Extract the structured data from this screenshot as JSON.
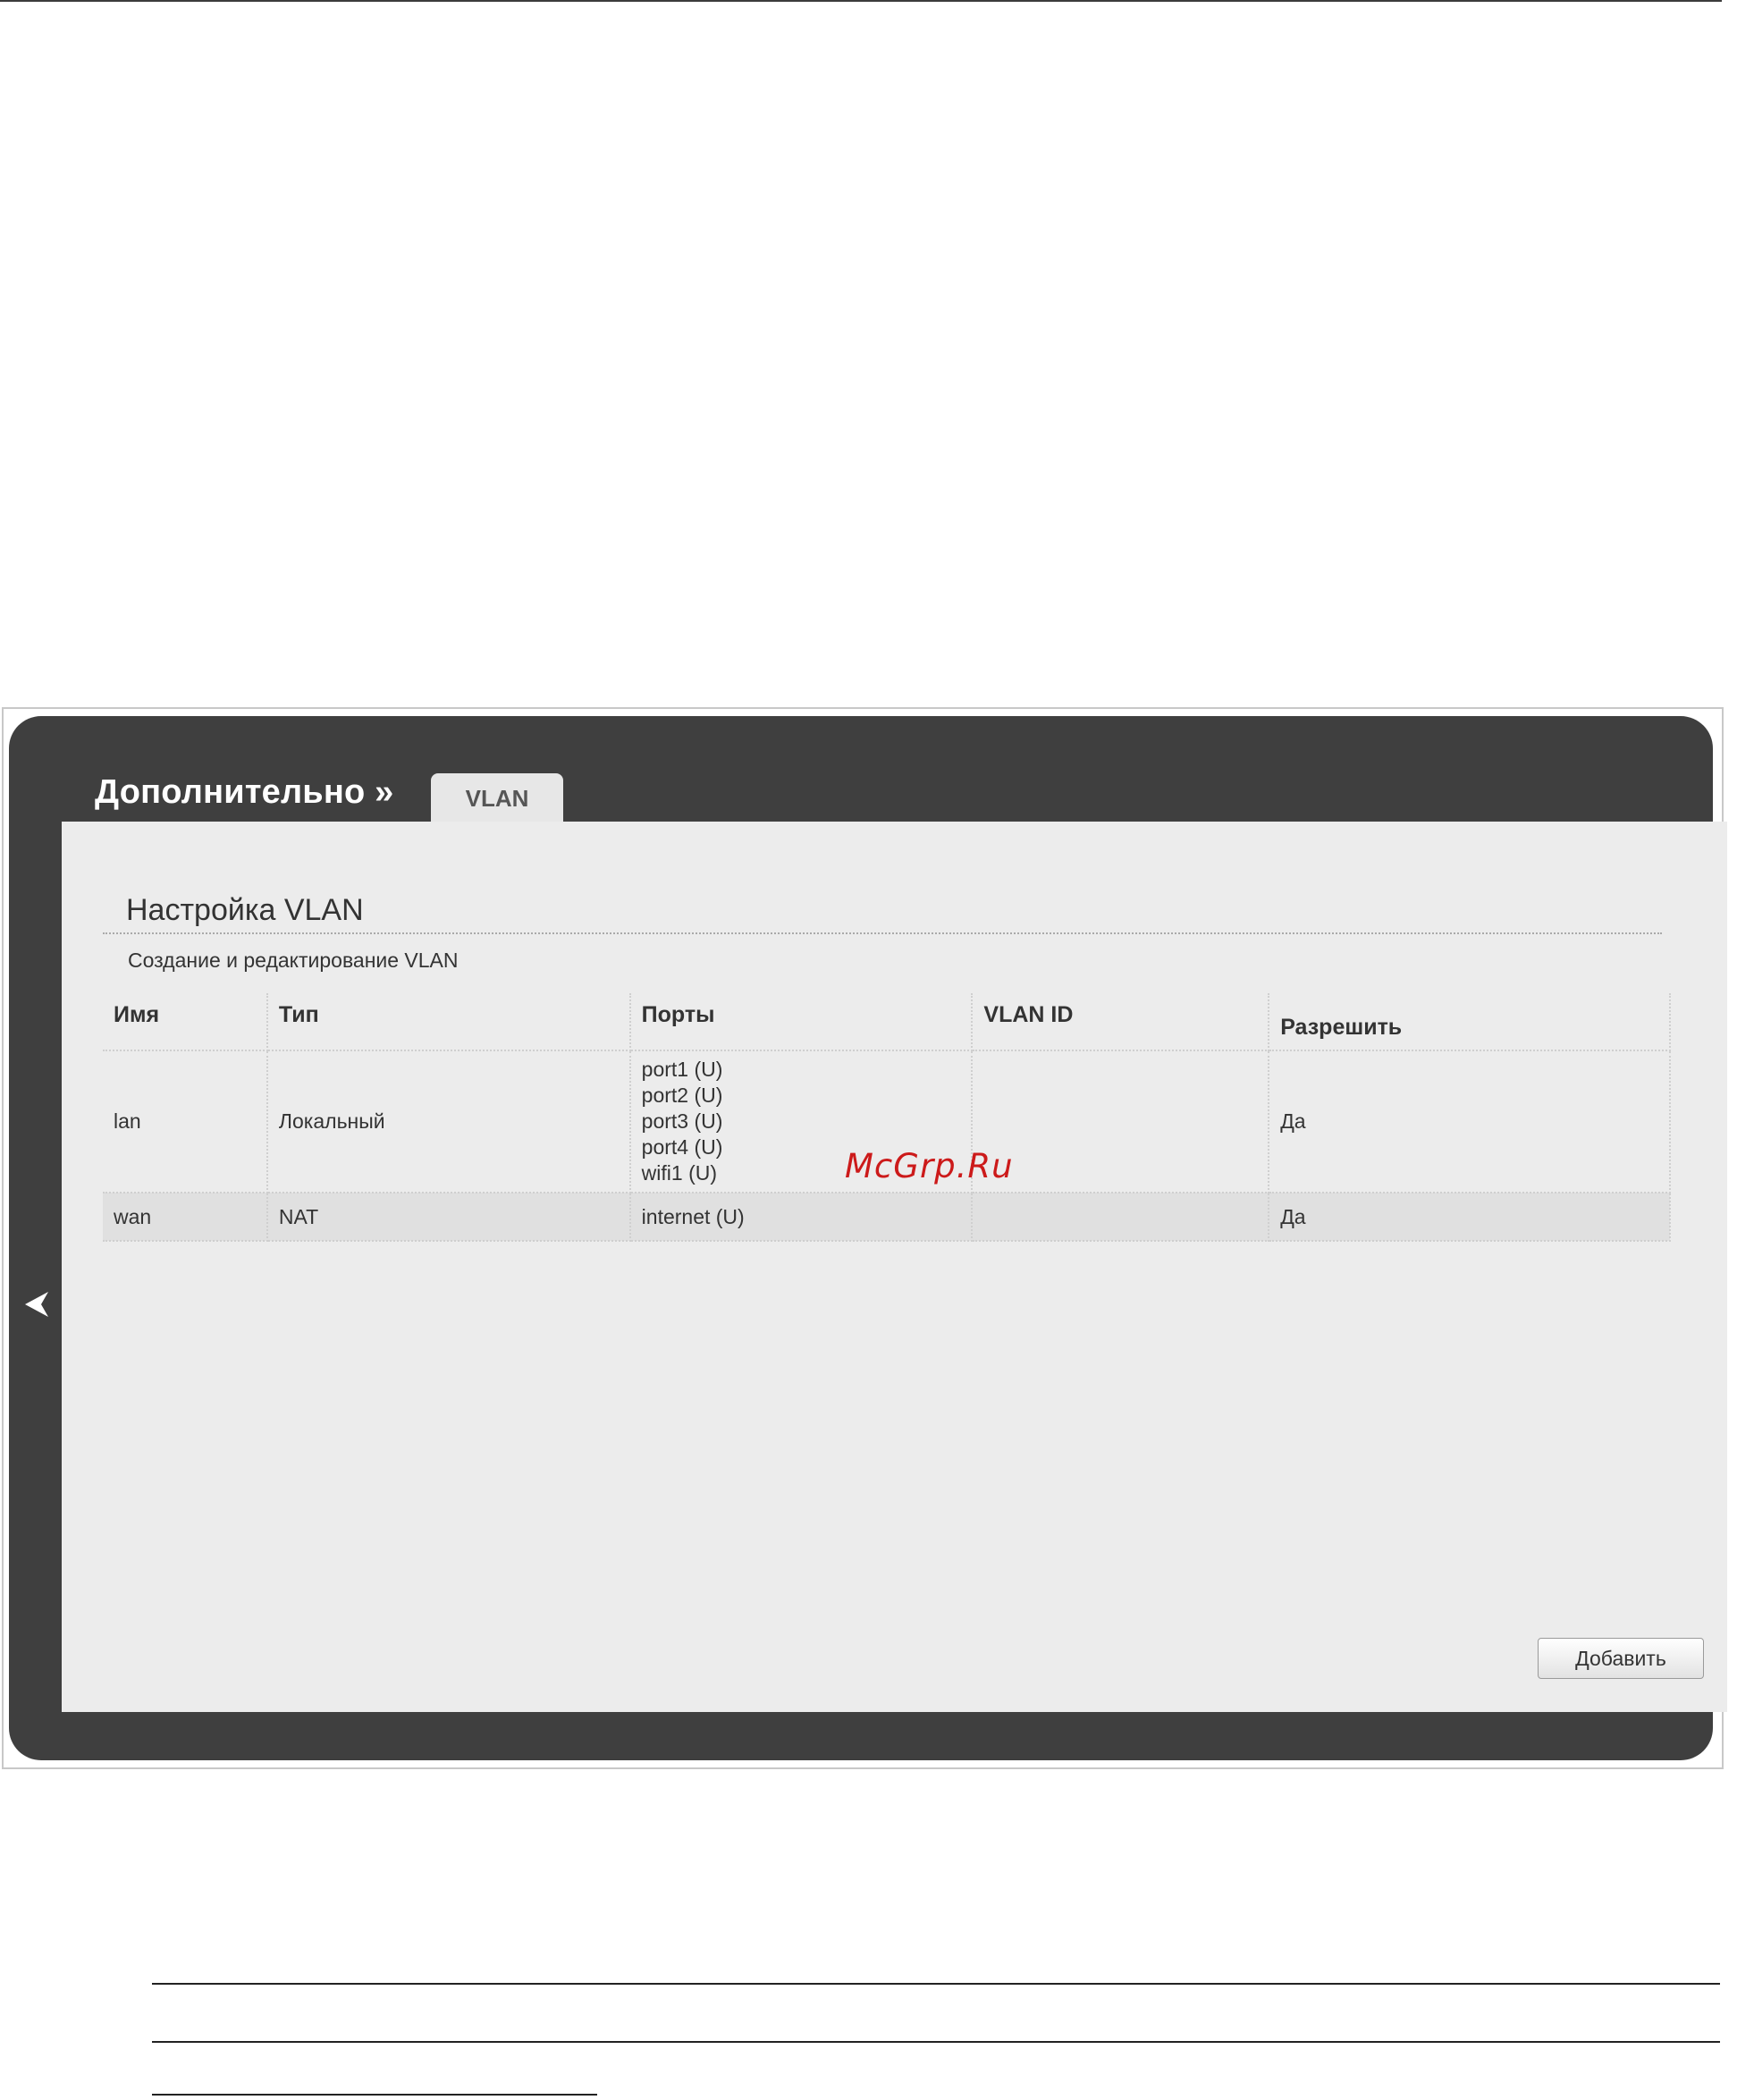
{
  "header": {
    "section": "Дополнительно »",
    "tab": "VLAN"
  },
  "content": {
    "title": "Настройка VLAN",
    "subtitle": "Создание и редактирование VLAN"
  },
  "table": {
    "columns": [
      "Имя",
      "Тип",
      "Порты",
      "VLAN ID",
      "Разрешить"
    ],
    "rows": [
      {
        "name": "lan",
        "type": "Локальный",
        "ports": [
          "port1 (U)",
          "port2 (U)",
          "port3 (U)",
          "port4 (U)",
          "wifi1 (U)"
        ],
        "vlan_id": "",
        "enabled": "Да"
      },
      {
        "name": "wan",
        "type": "NAT",
        "ports": [
          "internet (U)"
        ],
        "vlan_id": "",
        "enabled": "Да"
      }
    ]
  },
  "actions": {
    "add_label": "Добавить"
  },
  "watermark": "McGrp.Ru",
  "icons": {
    "back": "chevron-left-icon"
  },
  "colors": {
    "frame_dark": "#3f3f3f",
    "panel": "#ececec",
    "watermark": "#cc1a1a"
  }
}
